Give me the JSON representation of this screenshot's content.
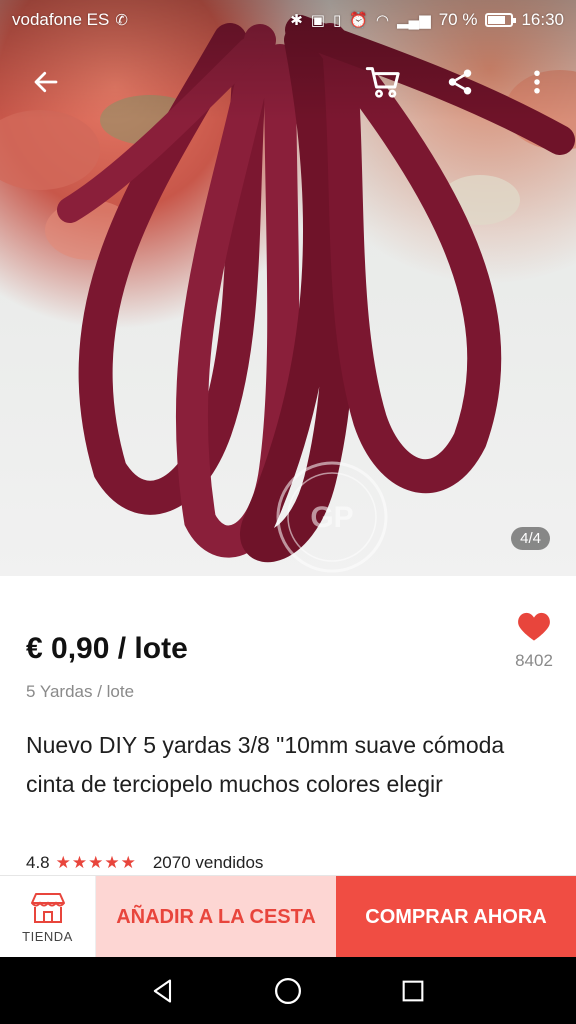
{
  "status_bar": {
    "carrier": "vodafone ES",
    "battery_percent": "70 %",
    "time": "16:30"
  },
  "app_bar": {
    "back_icon": "arrow-left-icon",
    "cart_icon": "cart-icon",
    "share_icon": "share-icon",
    "more_icon": "more-vertical-icon"
  },
  "gallery": {
    "counter": "4/4"
  },
  "product": {
    "price": "€ 0,90 / lote",
    "unit": "5 Yardas / lote",
    "favorites_count": "8402",
    "title": "Nuevo DIY 5 yardas 3/8 \"10mm suave cómoda cinta de terciopelo muchos colores elegir",
    "rating": "4.8",
    "stars": "★★★★★",
    "sold": "2070 vendidos"
  },
  "actions": {
    "store_label": "TIENDA",
    "add_to_cart": "AÑADIR A LA CESTA",
    "buy_now": "COMPRAR AHORA"
  },
  "colors": {
    "accent": "#f04d43",
    "accent_light": "#fdd6d3",
    "heart": "#e8453c"
  }
}
